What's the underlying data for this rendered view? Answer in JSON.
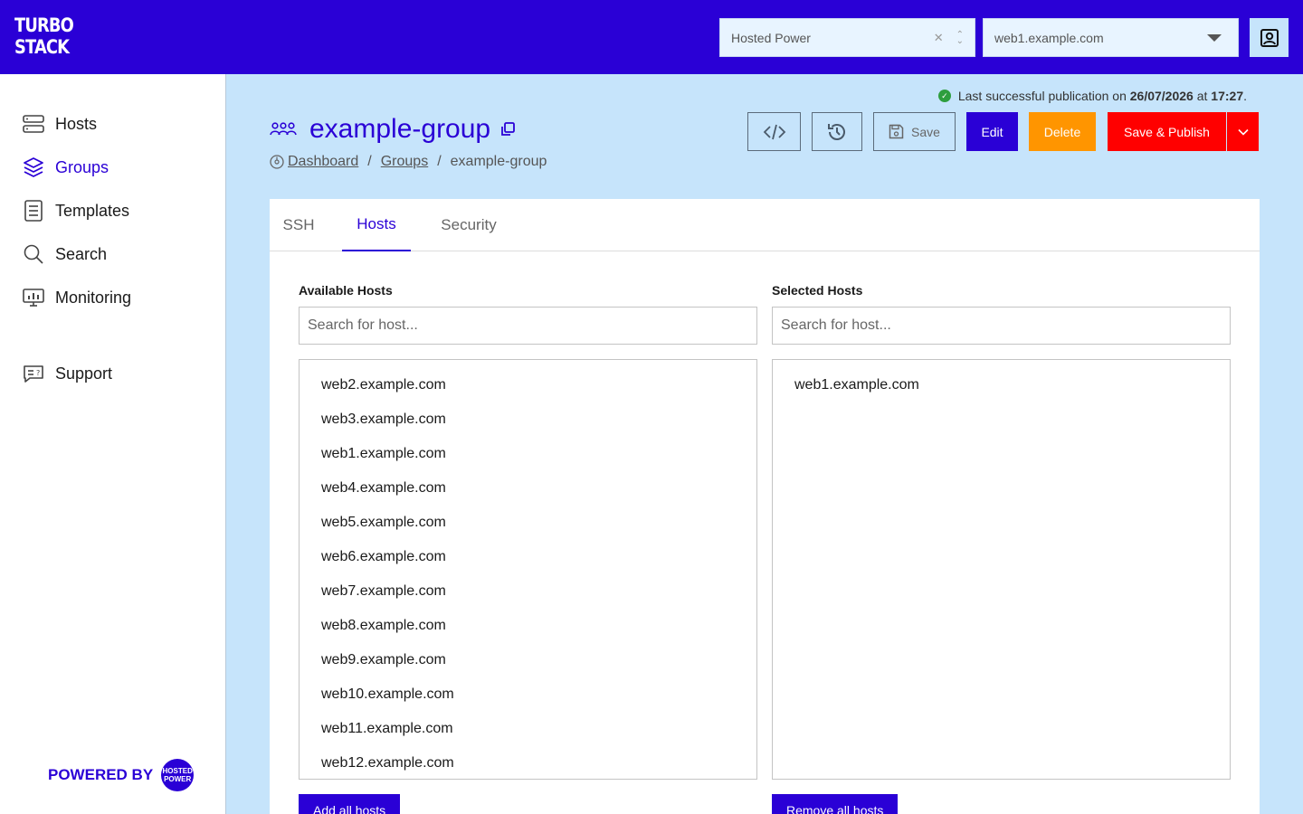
{
  "app": {
    "logo_line1": "TURBO",
    "logo_line2": "STACK"
  },
  "header": {
    "org_select_value": "Hosted Power",
    "host_select_value": "web1.example.com"
  },
  "sidebar": {
    "items": [
      {
        "label": "Hosts",
        "icon": "server-icon"
      },
      {
        "label": "Groups",
        "icon": "layers-icon"
      },
      {
        "label": "Templates",
        "icon": "template-icon"
      },
      {
        "label": "Search",
        "icon": "search-icon"
      },
      {
        "label": "Monitoring",
        "icon": "monitor-icon"
      },
      {
        "label": "Support",
        "icon": "support-icon"
      }
    ],
    "powered_by": "POWERED BY",
    "powered_badge": "HOSTED POWER"
  },
  "publication": {
    "prefix": "Last successful publication on",
    "date": "26/07/2026",
    "at": "at",
    "time": "17:27",
    "suffix": "."
  },
  "page": {
    "title": "example-group",
    "breadcrumb": [
      "Dashboard",
      "Groups",
      "example-group"
    ]
  },
  "toolbar": {
    "save_label": "Save",
    "edit_label": "Edit",
    "delete_label": "Delete",
    "publish_label": "Save & Publish"
  },
  "tabs": [
    "SSH",
    "Hosts",
    "Security"
  ],
  "available": {
    "label": "Available Hosts",
    "placeholder": "Search for host...",
    "hosts": [
      "web2.example.com",
      "web3.example.com",
      "web1.example.com",
      "web4.example.com",
      "web5.example.com",
      "web6.example.com",
      "web7.example.com",
      "web8.example.com",
      "web9.example.com",
      "web10.example.com",
      "web11.example.com",
      "web12.example.com"
    ],
    "action_label": "Add all hosts"
  },
  "selected": {
    "label": "Selected Hosts",
    "placeholder": "Search for host...",
    "hosts": [
      "web1.example.com"
    ],
    "action_label": "Remove all hosts"
  },
  "colors": {
    "brand": "#2a00d6",
    "delete": "#ff9500",
    "publish": "#ff0000",
    "success": "#2e9e3e",
    "background": "#c6e4fb"
  }
}
